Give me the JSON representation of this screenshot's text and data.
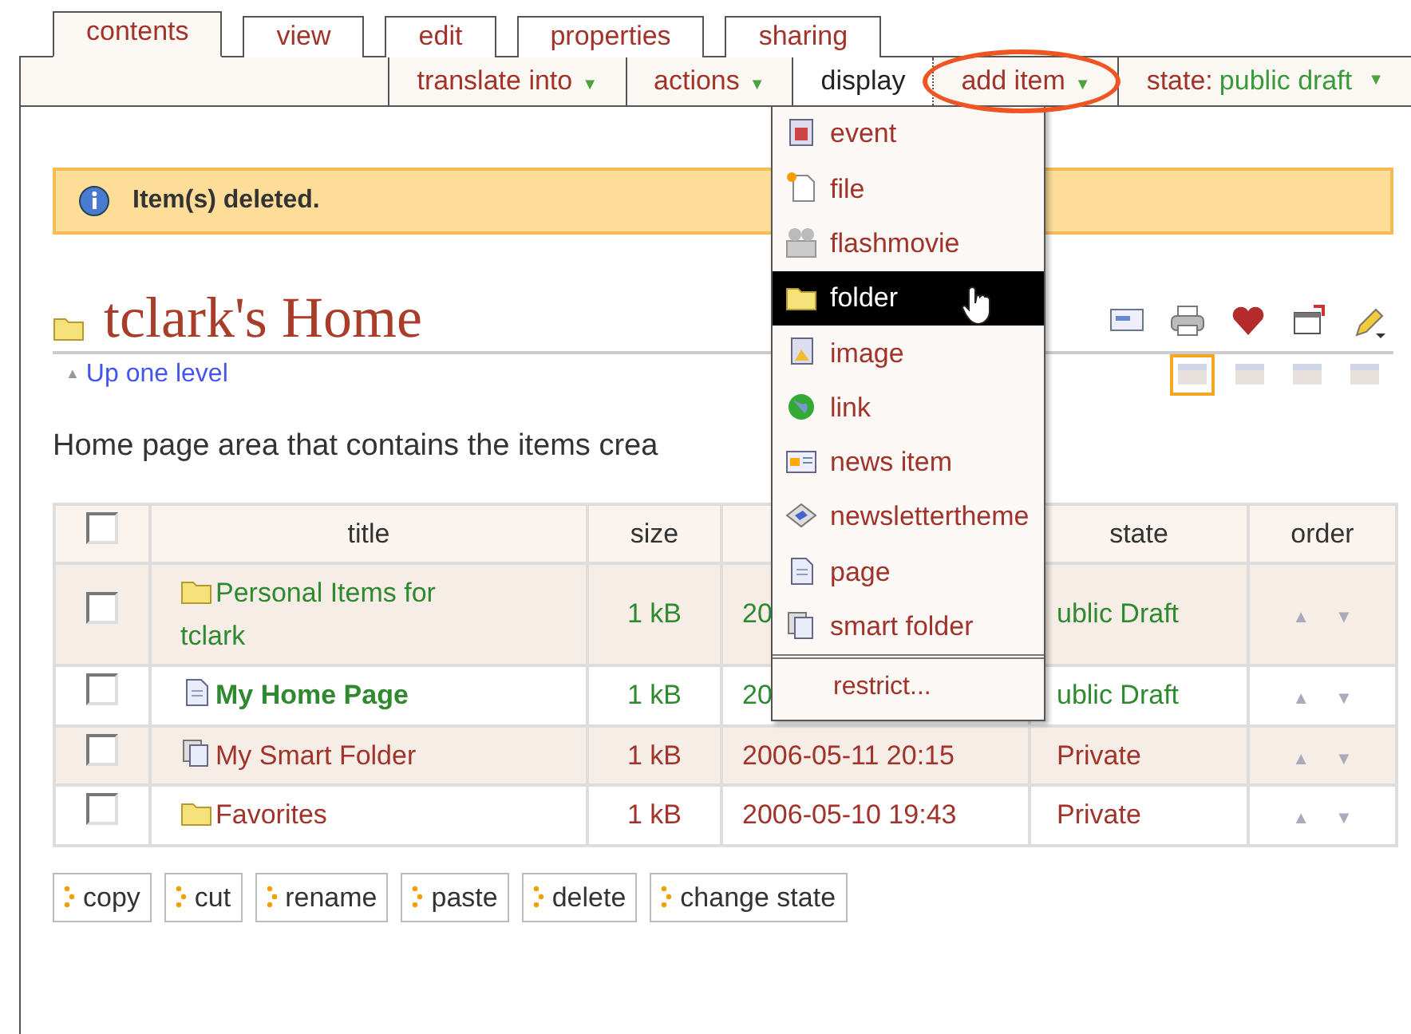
{
  "tabs": [
    {
      "label": "contents",
      "selected": true
    },
    {
      "label": "view",
      "selected": false
    },
    {
      "label": "edit",
      "selected": false
    },
    {
      "label": "properties",
      "selected": false
    },
    {
      "label": "sharing",
      "selected": false
    }
  ],
  "actions_bar": [
    {
      "kind": "menu",
      "label": "translate into",
      "arrow": "▼",
      "highlighted": false
    },
    {
      "kind": "menu",
      "label": "actions",
      "arrow": "▼",
      "highlighted": false
    },
    {
      "kind": "plain",
      "label": "display"
    },
    {
      "kind": "menu",
      "label": "add item",
      "arrow": "▼",
      "highlighted": true
    },
    {
      "kind": "state",
      "label": "state:",
      "value": "public draft",
      "arrow": "▼"
    }
  ],
  "add_item_menu": {
    "items": [
      {
        "kind": "event",
        "label": "event",
        "selected": false
      },
      {
        "kind": "file",
        "label": "file",
        "selected": false
      },
      {
        "kind": "flash",
        "label": "flashmovie",
        "selected": false
      },
      {
        "kind": "folder",
        "label": "folder",
        "selected": true
      },
      {
        "kind": "image",
        "label": "image",
        "selected": false
      },
      {
        "kind": "link",
        "label": "link",
        "selected": false
      },
      {
        "kind": "news",
        "label": "news item",
        "selected": false
      },
      {
        "kind": "newsletter",
        "label": "newslettertheme",
        "selected": false
      },
      {
        "kind": "page",
        "label": "page",
        "selected": false
      },
      {
        "kind": "smart",
        "label": "smart folder",
        "selected": false
      }
    ],
    "footer": "restrict..."
  },
  "message": "Item(s) deleted.",
  "heading": "tclark's Home",
  "view_modes": [
    {
      "selected": true
    },
    {
      "selected": false
    },
    {
      "selected": false
    },
    {
      "selected": false
    }
  ],
  "up_link": {
    "arrow": "▲",
    "label": "Up one level"
  },
  "description": "Home page area that contains the items crea",
  "table": {
    "columns": [
      {
        "kind": "select_all",
        "checked": false
      },
      {
        "kind": "text",
        "label": "title"
      },
      {
        "kind": "text",
        "label": "size"
      },
      {
        "kind": "hidden"
      },
      {
        "kind": "text",
        "label": "state"
      },
      {
        "kind": "text",
        "label": "order"
      }
    ],
    "rows": [
      {
        "checked": false,
        "kind": "folder",
        "title": "Personal Items for tclark",
        "bold": false,
        "color": "#2f8a2f",
        "size": "1 kB",
        "modified": "20",
        "state": "ublic Draft",
        "up": "▲",
        "down": "▼"
      },
      {
        "checked": false,
        "kind": "page",
        "title": "My Home Page",
        "bold": true,
        "color": "#2f8a2f",
        "size": "1 kB",
        "modified": "20",
        "state": "ublic Draft",
        "up": "▲",
        "down": "▼"
      },
      {
        "checked": false,
        "kind": "smart",
        "title": "My Smart Folder",
        "bold": false,
        "color": "#a0332a",
        "size": "1 kB",
        "modified": "2006-05-11 20:15",
        "state": "Private",
        "up": "▲",
        "down": "▼"
      },
      {
        "checked": false,
        "kind": "folder",
        "title": "Favorites",
        "bold": false,
        "color": "#a0332a",
        "size": "1 kB",
        "modified": "2006-05-10 19:43",
        "state": "Private",
        "up": "▲",
        "down": "▼"
      }
    ]
  },
  "buttons": [
    "copy",
    "cut",
    "rename",
    "paste",
    "delete",
    "change state"
  ]
}
